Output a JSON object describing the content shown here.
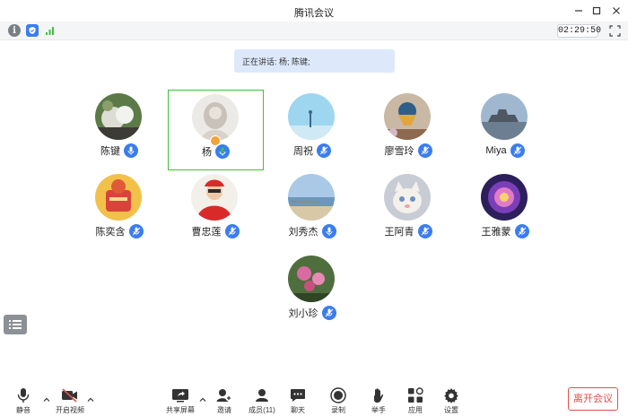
{
  "window": {
    "title": "腾讯会议"
  },
  "status": {
    "timer": "02:29:50"
  },
  "speaking": {
    "text": "正在讲话: 杨; 陈键;"
  },
  "participants": [
    {
      "name": "陈键",
      "mic": "on"
    },
    {
      "name": "杨",
      "mic": "speaking",
      "host": true,
      "active": true
    },
    {
      "name": "周祝",
      "mic": "off"
    },
    {
      "name": "廖雪玲",
      "mic": "off"
    },
    {
      "name": "Miya",
      "mic": "off"
    },
    {
      "name": "陈奕含",
      "mic": "off"
    },
    {
      "name": "曹忠莲",
      "mic": "off"
    },
    {
      "name": "刘秀杰",
      "mic": "off"
    },
    {
      "name": "王阿青",
      "mic": "off"
    },
    {
      "name": "王雅蒙",
      "mic": "off"
    },
    {
      "name": "刘小珍",
      "mic": "off"
    }
  ],
  "toolbar": {
    "mute": "静音",
    "video": "开启视频",
    "share": "共享屏幕",
    "invite": "邀请",
    "members": "成员(11)",
    "chat": "聊天",
    "record": "录制",
    "raise_hand": "举手",
    "apps": "应用",
    "settings": "设置",
    "leave": "离开会议"
  },
  "colors": {
    "accent": "#3a7df0",
    "active_border": "#3ec23a",
    "leave": "#e0504b"
  }
}
